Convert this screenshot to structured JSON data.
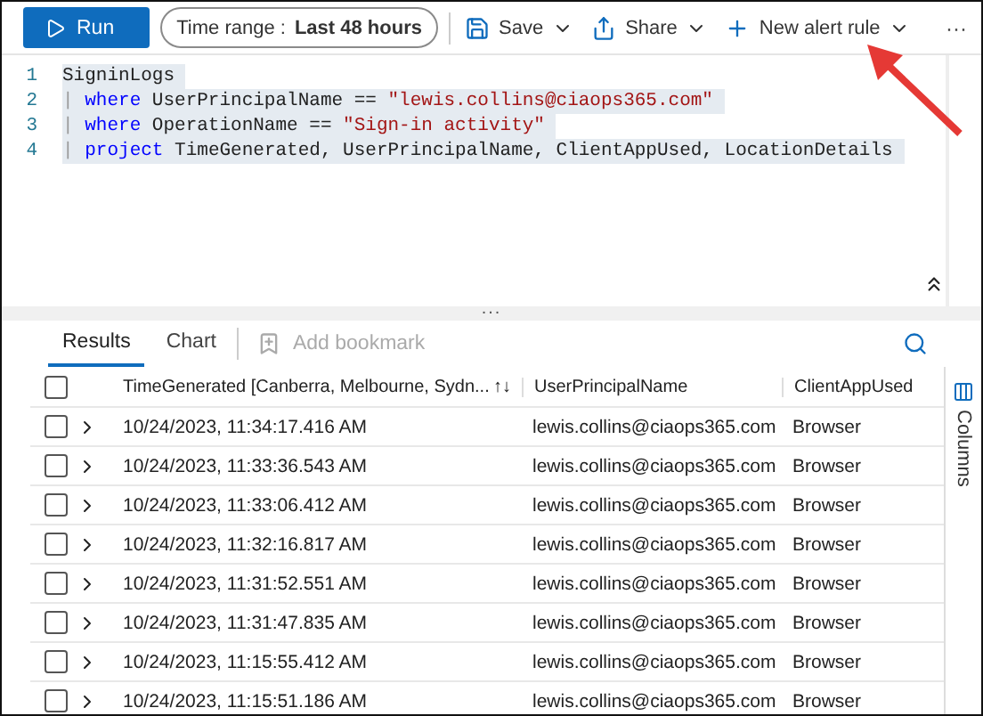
{
  "toolbar": {
    "run": "Run",
    "time_range": {
      "label": "Time range :",
      "value": "Last 48 hours"
    },
    "actions": [
      {
        "kind": "save",
        "label": "Save"
      },
      {
        "kind": "share",
        "label": "Share"
      },
      {
        "kind": "alert",
        "label": "New alert rule"
      }
    ],
    "more": "···"
  },
  "editor": {
    "lines": [
      {
        "number": "1",
        "tokens": [
          {
            "kind": "plain",
            "text": "SigninLogs"
          }
        ]
      },
      {
        "number": "2",
        "tokens": [
          {
            "kind": "pipe",
            "text": "|"
          },
          {
            "kind": "keyword",
            "text": "where"
          },
          {
            "kind": "plain",
            "text": "UserPrincipalName =="
          },
          {
            "kind": "string",
            "text": "\"lewis.collins@ciaops365.com\""
          }
        ]
      },
      {
        "number": "3",
        "tokens": [
          {
            "kind": "pipe",
            "text": "|"
          },
          {
            "kind": "keyword",
            "text": "where"
          },
          {
            "kind": "plain",
            "text": "OperationName =="
          },
          {
            "kind": "string",
            "text": "\"Sign-in activity\""
          }
        ]
      },
      {
        "number": "4",
        "tokens": [
          {
            "kind": "pipe",
            "text": "|"
          },
          {
            "kind": "keyword",
            "text": "project"
          },
          {
            "kind": "plain",
            "text": "TimeGenerated, UserPrincipalName, ClientAppUsed, LocationDetails"
          }
        ]
      }
    ]
  },
  "splitter": "...",
  "tabs": [
    {
      "label": "Results",
      "selected": true
    },
    {
      "label": "Chart",
      "selected": false
    }
  ],
  "add_bookmark": {
    "label": "Add bookmark",
    "disabled": true
  },
  "table": {
    "select_all_checked": false,
    "sort_icon": "↑↓",
    "columns": [
      "TimeGenerated [Canberra, Melbourne, Sydn...",
      "UserPrincipalName",
      "ClientAppUsed"
    ],
    "rows": [
      {
        "checked": false,
        "cells": [
          "10/24/2023, 11:34:17.416 AM",
          "lewis.collins@ciaops365.com",
          "Browser"
        ]
      },
      {
        "checked": false,
        "cells": [
          "10/24/2023, 11:33:36.543 AM",
          "lewis.collins@ciaops365.com",
          "Browser"
        ]
      },
      {
        "checked": false,
        "cells": [
          "10/24/2023, 11:33:06.412 AM",
          "lewis.collins@ciaops365.com",
          "Browser"
        ]
      },
      {
        "checked": false,
        "cells": [
          "10/24/2023, 11:32:16.817 AM",
          "lewis.collins@ciaops365.com",
          "Browser"
        ]
      },
      {
        "checked": false,
        "cells": [
          "10/24/2023, 11:31:52.551 AM",
          "lewis.collins@ciaops365.com",
          "Browser"
        ]
      },
      {
        "checked": false,
        "cells": [
          "10/24/2023, 11:31:47.835 AM",
          "lewis.collins@ciaops365.com",
          "Browser"
        ]
      },
      {
        "checked": false,
        "cells": [
          "10/24/2023, 11:15:55.412 AM",
          "lewis.collins@ciaops365.com",
          "Browser"
        ]
      },
      {
        "checked": false,
        "cells": [
          "10/24/2023, 11:15:51.186 AM",
          "lewis.collins@ciaops365.com",
          "Browser"
        ]
      }
    ]
  },
  "columns_panel": "Columns"
}
